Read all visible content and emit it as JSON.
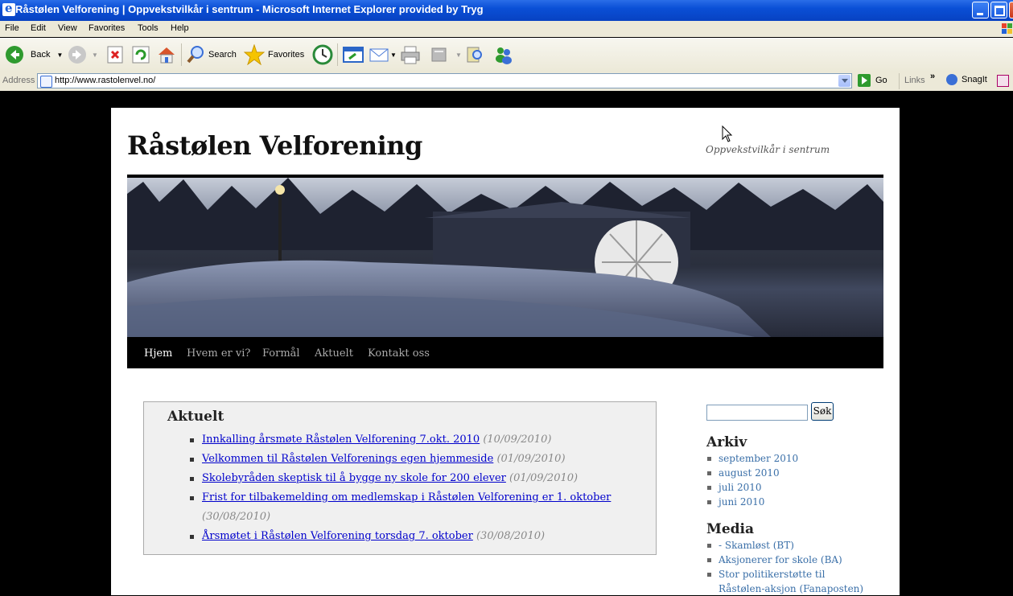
{
  "window": {
    "title": "Råstølen Velforening | Oppvekstvilkår i sentrum - Microsoft Internet Explorer provided by Tryg"
  },
  "menu": [
    "File",
    "Edit",
    "View",
    "Favorites",
    "Tools",
    "Help"
  ],
  "toolbar": {
    "back_label": "Back",
    "search_label": "Search",
    "favorites_label": "Favorites"
  },
  "address": {
    "label": "Address",
    "url": "http://www.rastolenvel.no/",
    "go_label": "Go",
    "links_label": "Links",
    "snagit_label": "SnagIt"
  },
  "site": {
    "title": "Råstølen Velforening",
    "description": "Oppvekstvilkår i sentrum"
  },
  "nav": [
    {
      "label": "Hjem",
      "active": true
    },
    {
      "label": "Hvem er vi?",
      "active": false
    },
    {
      "label": "Formål",
      "active": false
    },
    {
      "label": "Aktuelt",
      "active": false
    },
    {
      "label": "Kontakt oss",
      "active": false
    }
  ],
  "news": {
    "heading": "Aktuelt",
    "items": [
      {
        "title": "Innkalling årsmøte Råstølen Velforening 7.okt. 2010",
        "date": "(10/09/2010)"
      },
      {
        "title": "Velkommen til Råstølen Velforenings egen hjemmeside",
        "date": "(01/09/2010)"
      },
      {
        "title": "Skolebyråden skeptisk til å bygge ny skole for 200 elever",
        "date": "(01/09/2010)"
      },
      {
        "title": "Frist for tilbakemelding om medlemskap i Råstølen Velforening er 1. oktober",
        "date": "(30/08/2010)"
      },
      {
        "title": "Årsmøtet i Råstølen Velforening torsdag 7. oktober",
        "date": "(30/08/2010)"
      }
    ]
  },
  "sidebar": {
    "search_button": "Søk",
    "archive_heading": "Arkiv",
    "archive": [
      "september 2010",
      "august 2010",
      "juli 2010",
      "juni 2010"
    ],
    "media_heading": "Media",
    "media": [
      "- Skamløst (BT)",
      "Aksjonerer for skole (BA)",
      "Stor politikerstøtte til Råstølen-aksjon (Fanaposten)"
    ]
  }
}
